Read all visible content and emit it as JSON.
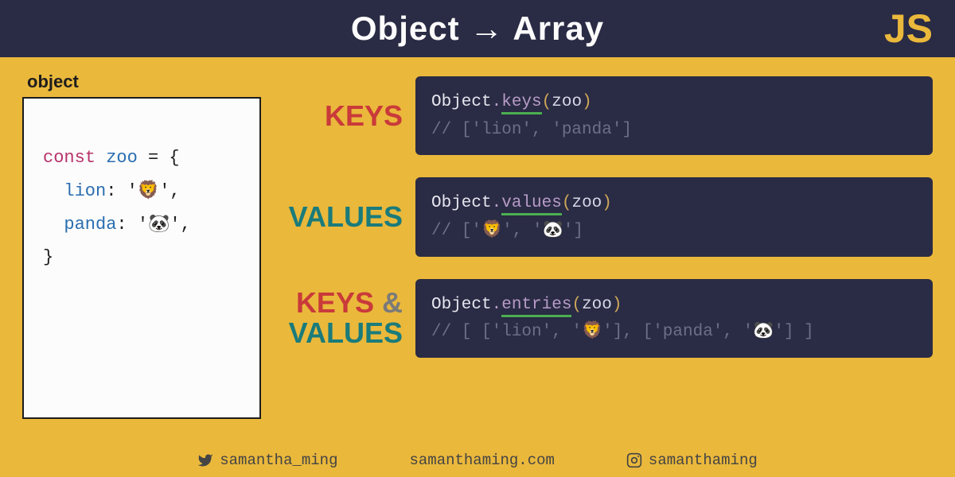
{
  "header": {
    "title": "Object → Array",
    "lang": "JS"
  },
  "left": {
    "label": "object",
    "code": {
      "kw": "const",
      "var": "zoo",
      "eq": " = {",
      "line1_key": "  lion",
      "line1_val": ": '🦁',",
      "line2_key": "  panda",
      "line2_val": ": '🐼',",
      "close": "}"
    }
  },
  "rows": [
    {
      "label_html": "keys",
      "obj": "Object",
      "dot": ".",
      "method": "keys",
      "open": "(",
      "arg": "zoo",
      "close": ")",
      "comment": "// ['lion', 'panda']"
    },
    {
      "label_html": "values",
      "obj": "Object",
      "dot": ".",
      "method": "values",
      "open": "(",
      "arg": "zoo",
      "close": ")",
      "comment": "// ['🦁', '🐼']"
    },
    {
      "label_html": "keysvalues",
      "obj": "Object",
      "dot": ".",
      "method": "entries",
      "open": "(",
      "arg": "zoo",
      "close": ")",
      "comment": "// [ ['lion', '🦁'], ['panda', '🐼'] ]"
    }
  ],
  "labels": {
    "keys": "KEYS",
    "values": "VALUES",
    "and": "&"
  },
  "footer": {
    "twitter": "samantha_ming",
    "site": "samanthaming.com",
    "instagram": "samanthaming"
  }
}
